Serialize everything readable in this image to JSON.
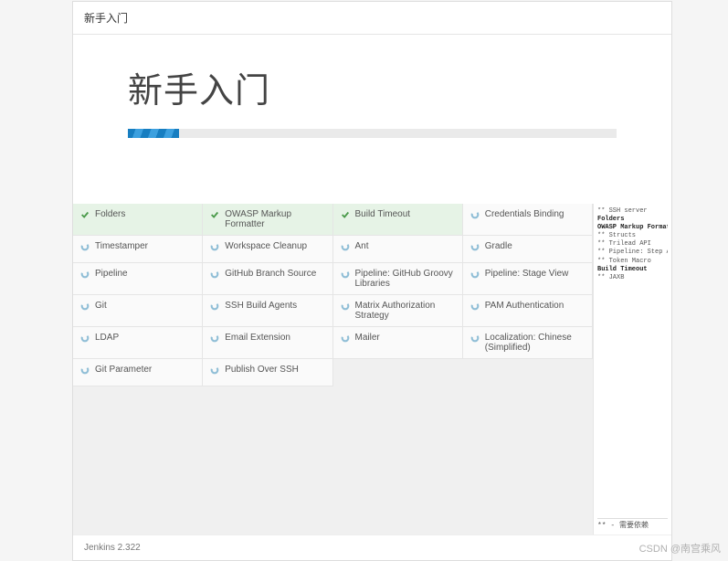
{
  "topbar": {
    "title": "新手入门"
  },
  "header": {
    "title": "新手入门"
  },
  "plugins": [
    {
      "name": "Folders",
      "status": "done"
    },
    {
      "name": "OWASP Markup Formatter",
      "status": "done"
    },
    {
      "name": "Build Timeout",
      "status": "done"
    },
    {
      "name": "Credentials Binding",
      "status": "pending"
    },
    {
      "name": "Timestamper",
      "status": "pending"
    },
    {
      "name": "Workspace Cleanup",
      "status": "pending"
    },
    {
      "name": "Ant",
      "status": "pending"
    },
    {
      "name": "Gradle",
      "status": "pending"
    },
    {
      "name": "Pipeline",
      "status": "pending"
    },
    {
      "name": "GitHub Branch Source",
      "status": "pending"
    },
    {
      "name": "Pipeline: GitHub Groovy Libraries",
      "status": "pending"
    },
    {
      "name": "Pipeline: Stage View",
      "status": "pending"
    },
    {
      "name": "Git",
      "status": "pending"
    },
    {
      "name": "SSH Build Agents",
      "status": "pending"
    },
    {
      "name": "Matrix Authorization Strategy",
      "status": "pending"
    },
    {
      "name": "PAM Authentication",
      "status": "pending"
    },
    {
      "name": "LDAP",
      "status": "pending"
    },
    {
      "name": "Email Extension",
      "status": "pending"
    },
    {
      "name": "Mailer",
      "status": "pending"
    },
    {
      "name": "Localization: Chinese (Simplified)",
      "status": "pending"
    },
    {
      "name": "Git Parameter",
      "status": "pending"
    },
    {
      "name": "Publish Over SSH",
      "status": "pending"
    }
  ],
  "log": {
    "lines": [
      {
        "text": "** SSH server",
        "bold": false
      },
      {
        "text": "Folders",
        "bold": true
      },
      {
        "text": "OWASP Markup Formatter",
        "bold": true
      },
      {
        "text": "** Structs",
        "bold": false
      },
      {
        "text": "** Trilead API",
        "bold": false
      },
      {
        "text": "** Pipeline: Step API",
        "bold": false
      },
      {
        "text": "** Token Macro",
        "bold": false
      },
      {
        "text": "Build Timeout",
        "bold": true
      },
      {
        "text": "** JAXB",
        "bold": false
      }
    ],
    "footer": "** - 需要依赖"
  },
  "footer": {
    "version": "Jenkins 2.322"
  },
  "watermark": "CSDN @南宫乘风"
}
